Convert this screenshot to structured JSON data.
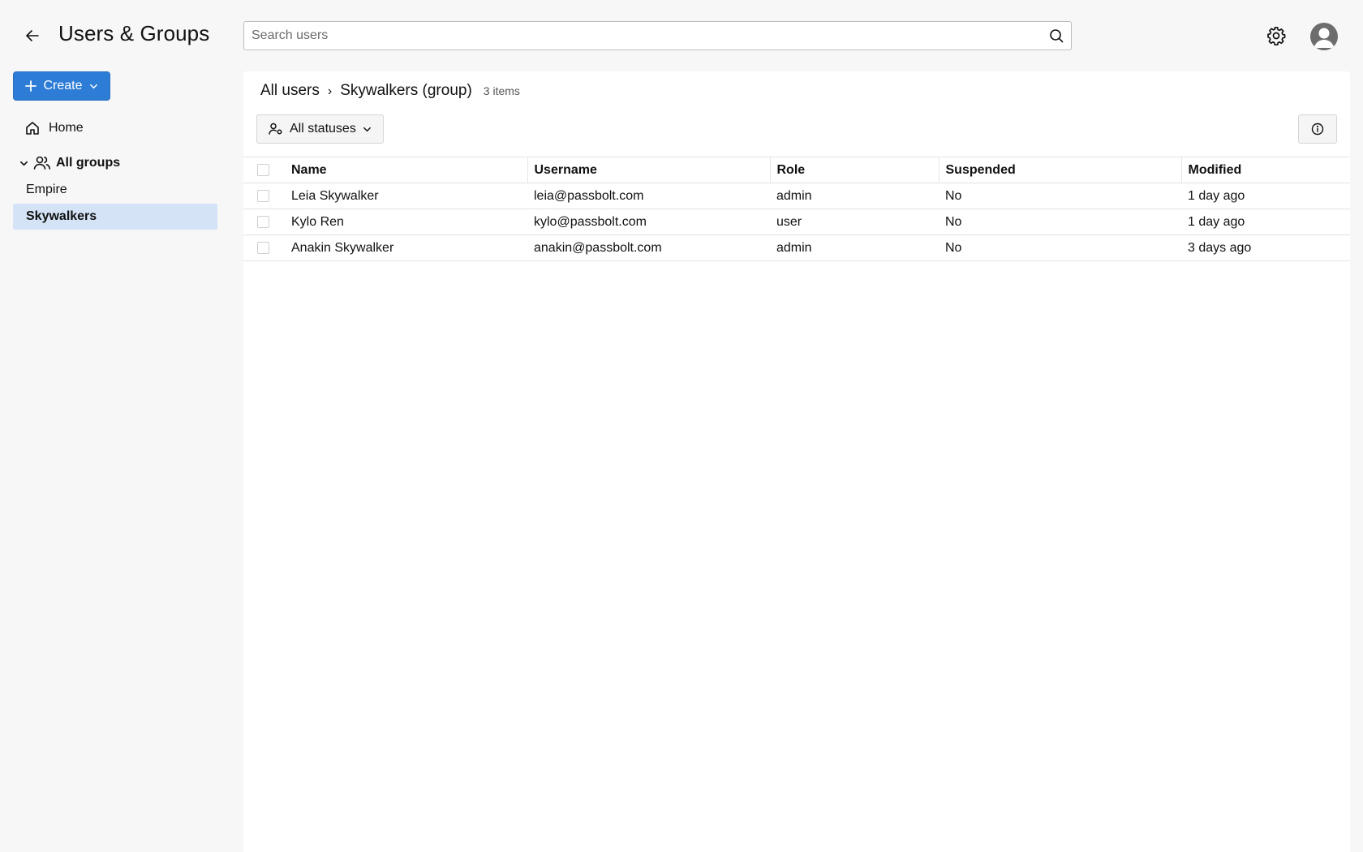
{
  "header": {
    "title": "Users & Groups",
    "search_placeholder": "Search users",
    "icons": [
      "arrow-left-icon",
      "search-icon",
      "gear-icon",
      "user-avatar-icon"
    ]
  },
  "sidebar": {
    "create_label": "Create",
    "home_label": "Home",
    "all_groups_label": "All groups",
    "groups": [
      {
        "label": "Empire",
        "selected": false
      },
      {
        "label": "Skywalkers",
        "selected": true
      }
    ]
  },
  "main": {
    "breadcrumb": {
      "root": "All users",
      "separator": "›",
      "current": "Skywalkers (group)",
      "count": "3 items"
    },
    "filter_label": "All statuses",
    "table": {
      "columns": [
        "Name",
        "Username",
        "Role",
        "Suspended",
        "Modified"
      ],
      "rows": [
        {
          "name": "Leia Skywalker",
          "username": "leia@passbolt.com",
          "role": "admin",
          "suspended": "No",
          "modified": "1 day ago"
        },
        {
          "name": "Kylo Ren",
          "username": "kylo@passbolt.com",
          "role": "user",
          "suspended": "No",
          "modified": "1 day ago"
        },
        {
          "name": "Anakin Skywalker",
          "username": "anakin@passbolt.com",
          "role": "admin",
          "suspended": "No",
          "modified": "3 days ago"
        }
      ]
    }
  },
  "colors": {
    "primary": "#2d7cd6",
    "selected_bg": "#d4e3f6",
    "page_bg": "#f7f7f7",
    "panel_bg": "#ffffff"
  }
}
